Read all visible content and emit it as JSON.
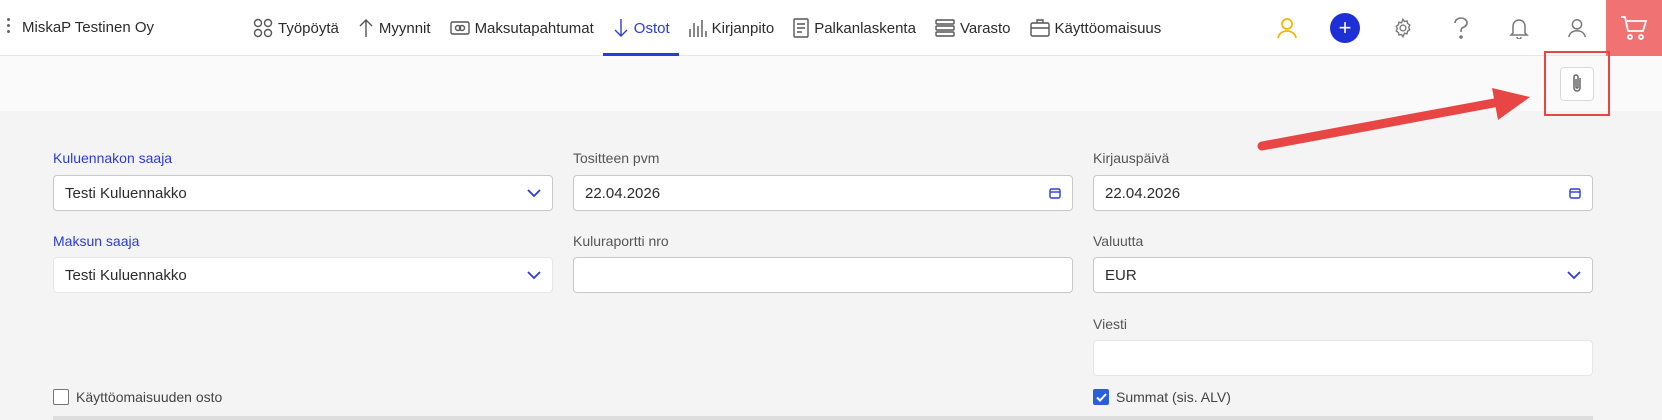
{
  "header": {
    "company": "MiskaP Testinen Oy",
    "nav": [
      {
        "label": "Työpöytä",
        "icon": "dashboard-icon"
      },
      {
        "label": "Myynnit",
        "icon": "arrow-up-icon"
      },
      {
        "label": "Maksutapahtumat",
        "icon": "payments-icon"
      },
      {
        "label": "Ostot",
        "icon": "arrow-down-icon",
        "active": true
      },
      {
        "label": "Kirjanpito",
        "icon": "bookkeeping-icon"
      },
      {
        "label": "Palkanlaskenta",
        "icon": "payroll-icon"
      },
      {
        "label": "Varasto",
        "icon": "inventory-icon"
      },
      {
        "label": "Käyttöomaisuus",
        "icon": "assets-icon"
      }
    ],
    "plus_label": "+"
  },
  "form": {
    "expense_recipient": {
      "label": "Kuluennakon saaja",
      "value": "Testi Kuluennakko"
    },
    "voucher_date": {
      "label": "Tositteen pvm",
      "value": "22.04.2026"
    },
    "posting_date": {
      "label": "Kirjauspäivä",
      "value": "22.04.2026"
    },
    "payee": {
      "label": "Maksun saaja",
      "value": "Testi Kuluennakko"
    },
    "expense_report": {
      "label": "Kuluraportti nro",
      "value": ""
    },
    "currency": {
      "label": "Valuutta",
      "value": "EUR"
    },
    "message": {
      "label": "Viesti",
      "value": ""
    },
    "asset_purchase": {
      "label": "Käyttöomaisuuden osto",
      "checked": false
    },
    "sums_incl_vat": {
      "label": "Summat (sis. ALV)",
      "checked": true
    }
  },
  "colors": {
    "accent": "#2b3bd6",
    "cart": "#f07272",
    "highlight": "#e84545",
    "user": "#f2b705"
  }
}
